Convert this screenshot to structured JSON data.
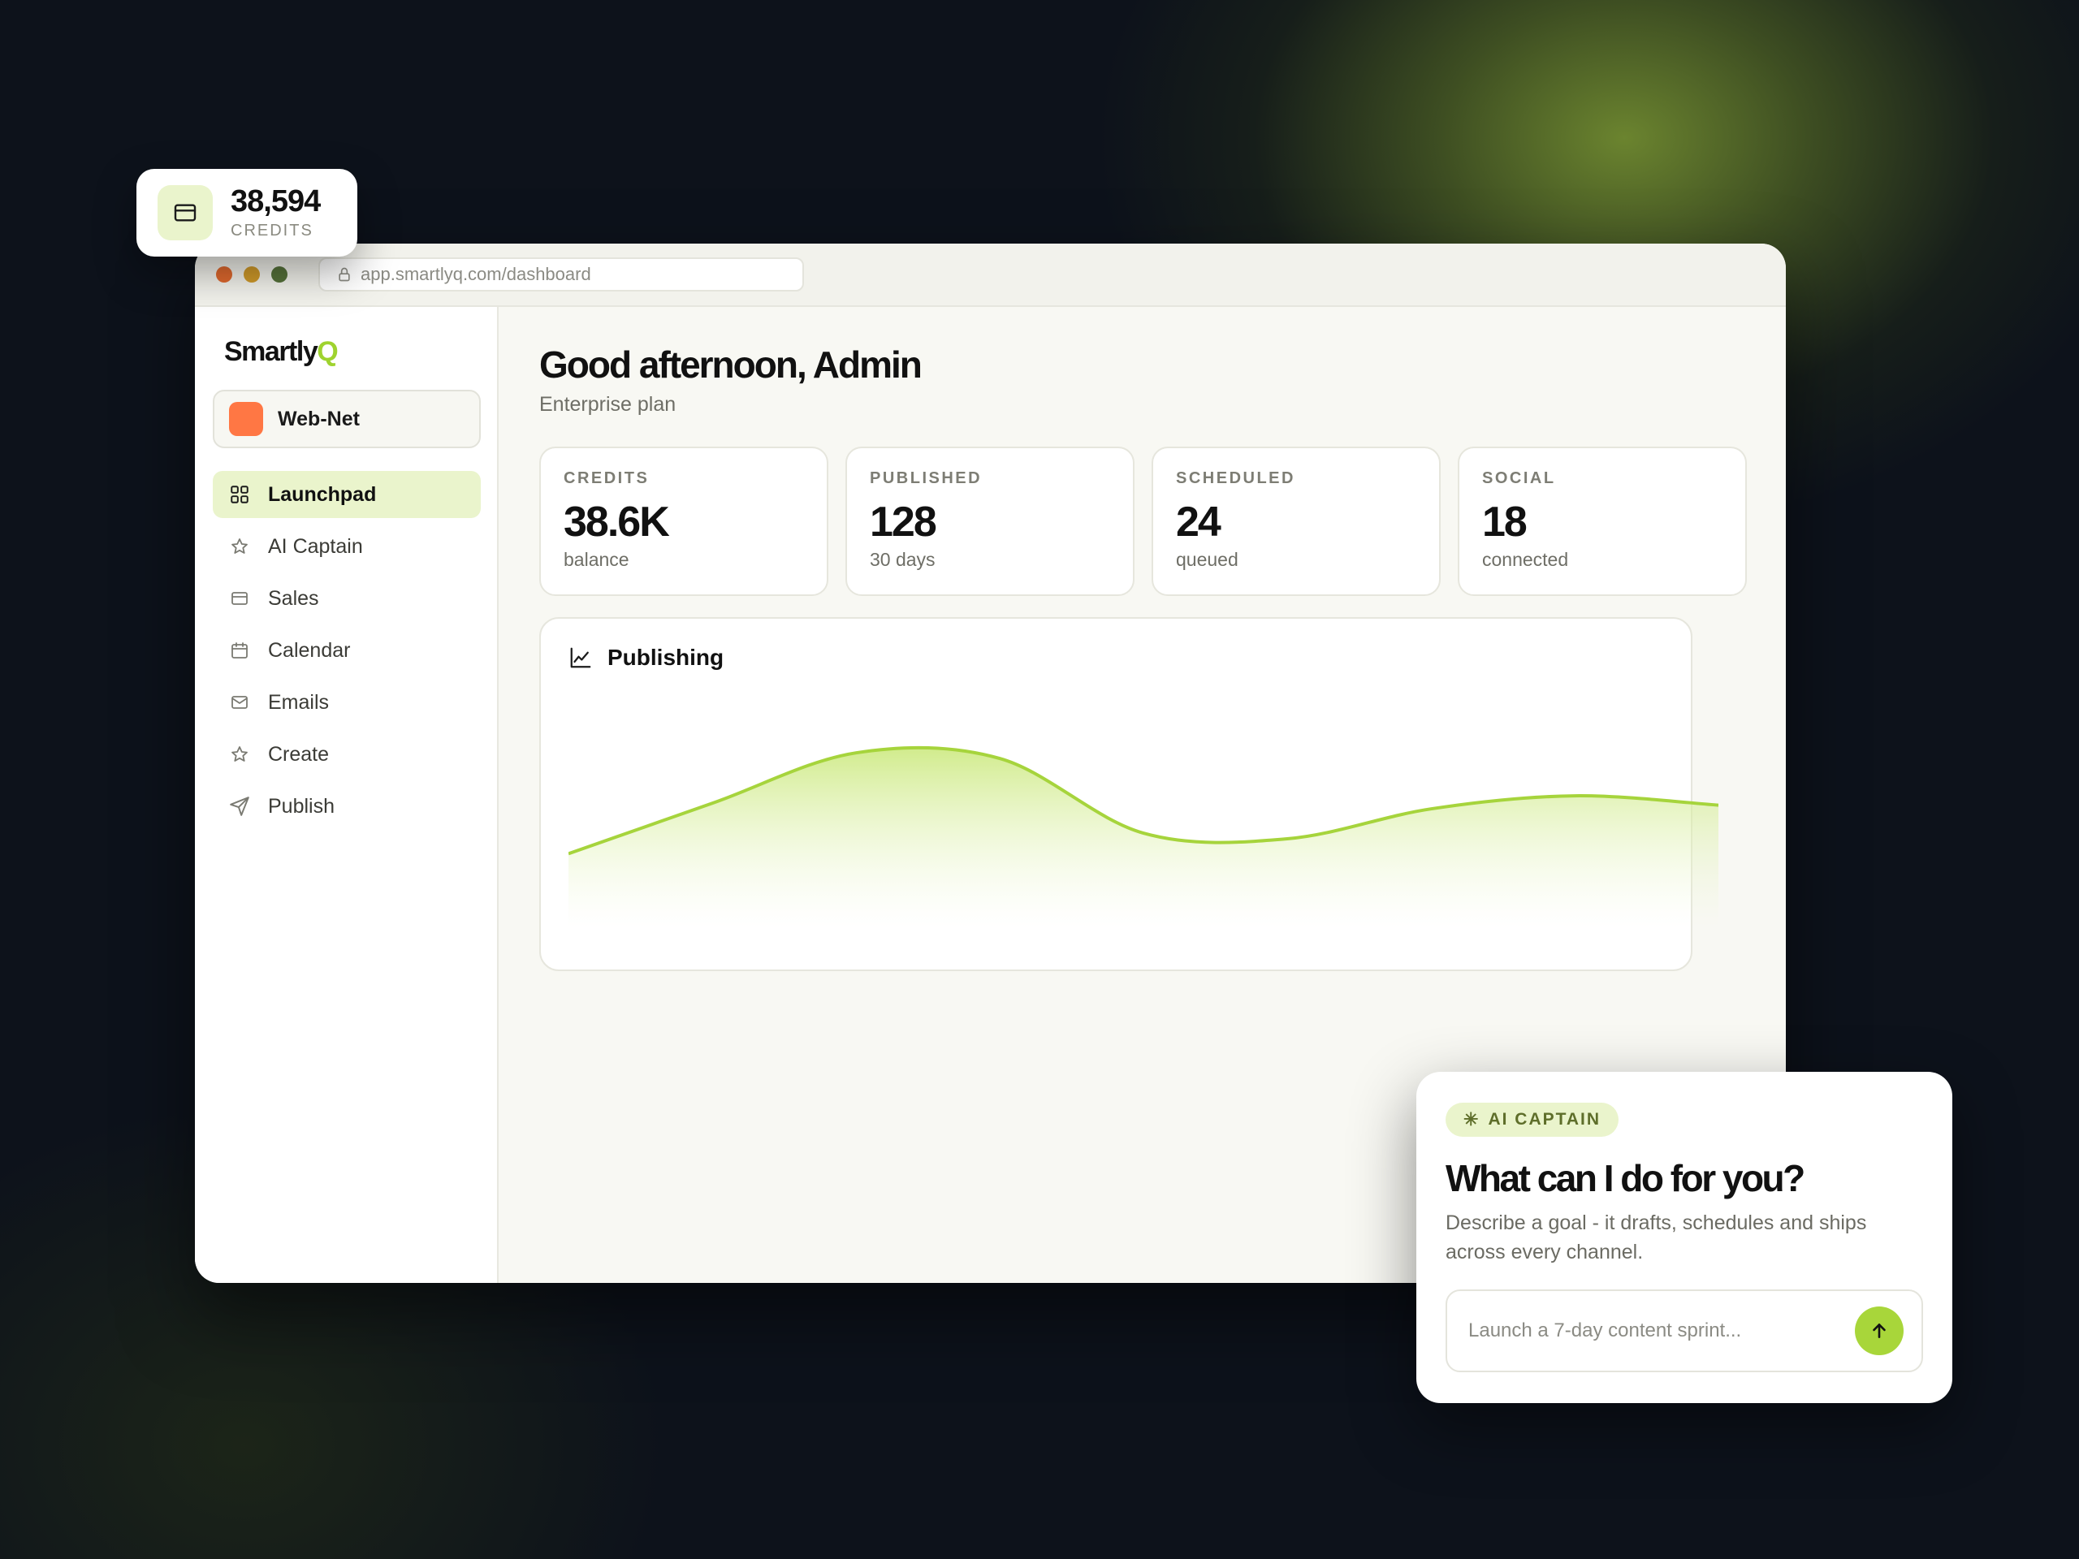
{
  "floating_credits": {
    "value": "38,594",
    "label": "CREDITS",
    "icon": "credit-card-icon"
  },
  "browser": {
    "url": "app.smartlyq.com/dashboard",
    "dots": [
      "#e0692e",
      "#d09a2a",
      "#56723a"
    ]
  },
  "sidebar": {
    "logo_text": "Smartly",
    "logo_accent": "Q",
    "workspace": {
      "name": "Web-Net",
      "color": "#ff7744"
    },
    "items": [
      {
        "label": "Launchpad",
        "icon": "grid-icon",
        "active": true
      },
      {
        "label": "AI Captain",
        "icon": "star-icon",
        "active": false
      },
      {
        "label": "Sales",
        "icon": "credit-card-icon",
        "active": false
      },
      {
        "label": "Calendar",
        "icon": "calendar-icon",
        "active": false
      },
      {
        "label": "Emails",
        "icon": "mail-icon",
        "active": false
      },
      {
        "label": "Create",
        "icon": "star-icon",
        "active": false
      },
      {
        "label": "Publish",
        "icon": "send-icon",
        "active": false
      }
    ]
  },
  "main": {
    "greeting": "Good afternoon, Admin",
    "plan": "Enterprise plan",
    "stats": [
      {
        "label": "CREDITS",
        "value": "38.6K",
        "sub": "balance"
      },
      {
        "label": "PUBLISHED",
        "value": "128",
        "sub": "30 days"
      },
      {
        "label": "SCHEDULED",
        "value": "24",
        "sub": "queued"
      },
      {
        "label": "SOCIAL",
        "value": "18",
        "sub": "connected"
      }
    ],
    "chart_title": "Publishing",
    "chart_icon": "line-chart-icon"
  },
  "chart_data": {
    "type": "area",
    "title": "Publishing",
    "xlabel": "",
    "ylabel": "",
    "grid": false,
    "legend": "none",
    "color": "#a6d43c",
    "x": [
      0,
      1,
      2,
      3,
      4,
      5,
      6,
      7,
      8
    ],
    "values": [
      0.22,
      0.49,
      0.76,
      0.73,
      0.33,
      0.3,
      0.46,
      0.53,
      0.48
    ],
    "ylim": [
      0,
      1
    ]
  },
  "ai_captain": {
    "badge": "AI CAPTAIN",
    "heading": "What can I do for you?",
    "description": "Describe a goal - it drafts, schedules and ships across every channel.",
    "input_placeholder": "Launch a 7-day content sprint...",
    "accent": "#a8d63a"
  }
}
